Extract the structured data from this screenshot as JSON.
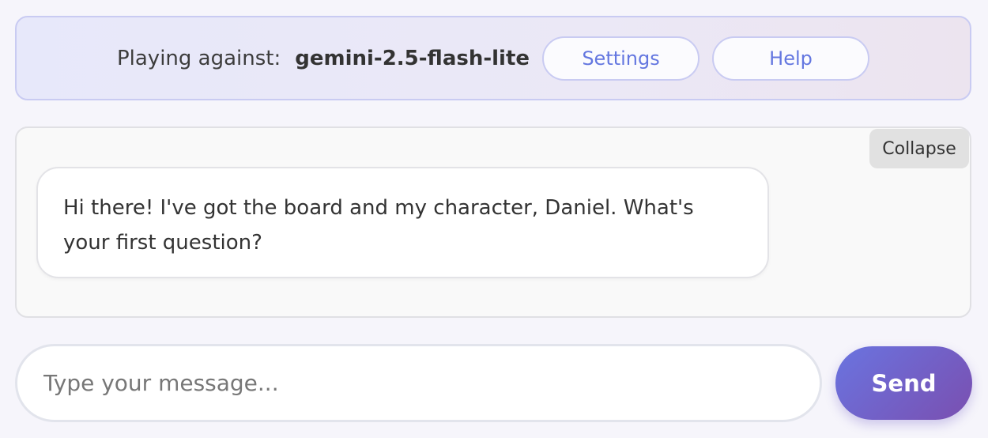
{
  "header": {
    "playing_label": "Playing against:",
    "model_name": "gemini-2.5-flash-lite",
    "settings_label": "Settings",
    "help_label": "Help"
  },
  "chat": {
    "collapse_label": "Collapse",
    "messages": [
      {
        "text": "Hi there! I've got the board and my character, Daniel. What's your first question?"
      }
    ]
  },
  "composer": {
    "placeholder": "Type your message...",
    "value": "",
    "send_label": "Send"
  },
  "colors": {
    "accent": "#6477e0",
    "send_gradient_start": "#6a74e0",
    "send_gradient_end": "#7a4fb0"
  }
}
